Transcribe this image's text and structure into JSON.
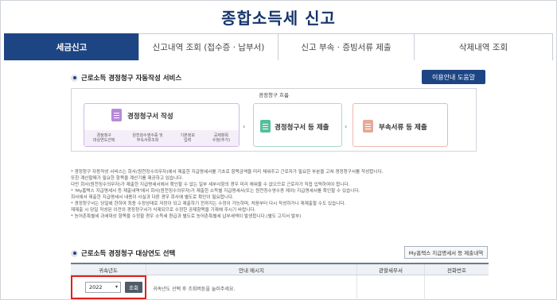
{
  "page_title": "종합소득세 신고",
  "tabs": [
    {
      "label": "세금신고",
      "active": true
    },
    {
      "label": "신고내역 조회 (접수증 · 납부서)",
      "active": false
    },
    {
      "label": "신고 부속 · 증빙서류 제출",
      "active": false
    },
    {
      "label": "삭제내역 조회",
      "active": false
    }
  ],
  "section1": {
    "title": "근로소득 경정청구 자동작성 서비스",
    "help_button": "이용안내 도움말",
    "flow_label": "경정청구 흐름",
    "step1": {
      "title": "경정청구서 작성",
      "subs": [
        "경정청구\n대상연도선택",
        "원천징수영수증 및\n부속서류조회",
        "기본정보\n입력",
        "공제항목\n수정(추가)"
      ]
    },
    "step2": {
      "title": "경정청구서 등 제출"
    },
    "step3": {
      "title": "부속서류 등 제출"
    }
  },
  "notes": [
    "* 경정청구 자동작성 서비스는 회사(원천징수의무자)에서 제출한 지급명세서를 기초로 항목금액을 미리 채워주고 근로자가 필요한 부분을 고쳐 경정청구서를 작성합니다.",
    "   또한 계산할때가 필요한 항목을 계산기를 제공하고 있습니다.",
    "   다만 회사(원천징수의무자)가 제출한 지급명세서에서 확인할 수 없는 일부 세부사항의 경우 미리 채워줄 수 없으므로 근로자가 직접 입력하여야 합니다.",
    "* 'My홈택스 지급명세서 등 제출내역'에서 회사(원천징수의무자)가 제출한 소득별 지급명세서(또는 원천징수영수증 제외) 지급명세서를 확인할 수 있습니다.",
    "   회사에서 제출한 지급명세서 내용이 사실과 다른 경우 회사에 별도로 확인이 필요합니다.",
    "* 경정청구서는 당일에 한하여 최종 수정상태로 저장이 되고 제출하기 전까지는 수정이 가능하며, 처음부터 다시 작성하거나 재제출할 수도 있습니다.",
    "   재제출 시 당일 작성된 이전의 경정청구서가 삭제되므로 수정한 공제항목을 기재해 주시기 바랍니다.",
    "* 농어촌특별세 과세대상 항목을 수정할 경우 소득세 환급과 별도로 농어촌특별세 납부세액이 발생합니다.(별도 고지서 발부)"
  ],
  "section2": {
    "title": "근로소득 경정청구 대상연도 선택",
    "hometax_button": "My홈택스 지급명세서 등 제출내역"
  },
  "table": {
    "headers": [
      "귀속년도",
      "안내 메시지",
      "관할세무서",
      "전화번호"
    ],
    "row": {
      "year": "2022",
      "lookup_button": "조회",
      "message": "귀속년도 선택 후 조회버튼을 눌러주세요.",
      "tax_office": "",
      "phone": ""
    }
  },
  "colors": {
    "primary": "#1d4584",
    "highlight": "#e0201e"
  },
  "icons": {
    "section_bullet": "bullet-icon",
    "step_doc": "document-icon",
    "arrow": "arrow-right-icon",
    "dropdown": "chevron-down-icon"
  }
}
